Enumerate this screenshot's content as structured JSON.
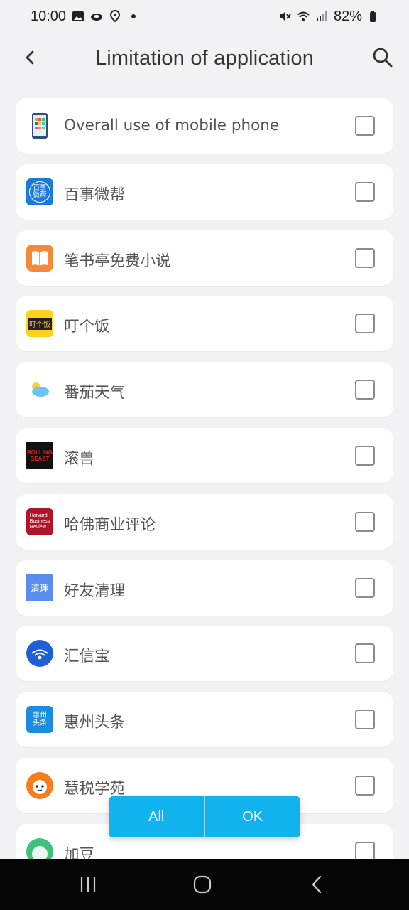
{
  "status": {
    "time": "10:00",
    "battery": "82%"
  },
  "header": {
    "title": "Limitation of application"
  },
  "apps": [
    {
      "label": "Overall use of mobile phone",
      "icon": "phone-icon",
      "checked": false
    },
    {
      "label": "百事微帮",
      "icon": "baishiweibang-app-icon",
      "checked": false
    },
    {
      "label": "笔书亭免费小说",
      "icon": "book-app-icon",
      "checked": false
    },
    {
      "label": "叮个饭",
      "icon": "dinggefan-app-icon",
      "checked": false
    },
    {
      "label": "番茄天气",
      "icon": "weather-app-icon",
      "checked": false
    },
    {
      "label": "滚兽",
      "icon": "rolling-beast-app-icon",
      "checked": false
    },
    {
      "label": "哈佛商业评论",
      "icon": "hbr-app-icon",
      "checked": false
    },
    {
      "label": "好友清理",
      "icon": "cleaner-app-icon",
      "checked": false
    },
    {
      "label": "汇信宝",
      "icon": "huixinbao-app-icon",
      "checked": false
    },
    {
      "label": "惠州头条",
      "icon": "huizhou-news-app-icon",
      "checked": false
    },
    {
      "label": "慧税学苑",
      "icon": "tax-academy-app-icon",
      "checked": false
    },
    {
      "label": "加豆",
      "icon": "jiadou-app-icon",
      "checked": false
    }
  ],
  "icon_text": {
    "baishi": "百事\n微帮",
    "dinggefan": "叮个饭",
    "rolling_beast": "ROLLING\nBEAST",
    "hbr": "Harvard\nBusiness\nReview",
    "cleaner": "清理",
    "huizhou": "惠州\n头条"
  },
  "actions": {
    "all_label": "All",
    "ok_label": "OK"
  },
  "colors": {
    "accent": "#11b3ef",
    "background": "#f2f2f4",
    "card": "#ffffff"
  }
}
